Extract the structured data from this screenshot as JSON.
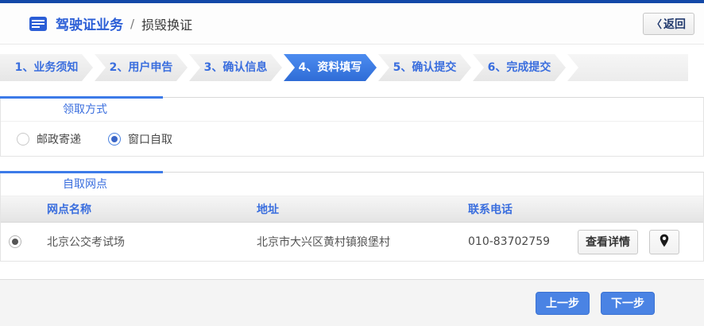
{
  "header": {
    "title": "驾驶证业务",
    "separator": "/",
    "subtitle": "损毁换证",
    "back_chevron": "〈",
    "back_label": "返回"
  },
  "steps": {
    "items": [
      {
        "label": "1、业务须知",
        "active": false
      },
      {
        "label": "2、用户申告",
        "active": false
      },
      {
        "label": "3、确认信息",
        "active": false
      },
      {
        "label": "4、资料填写",
        "active": true
      },
      {
        "label": "5、确认提交",
        "active": false
      },
      {
        "label": "6、完成提交",
        "active": false
      }
    ]
  },
  "pickup": {
    "title": "领取方式",
    "options": [
      {
        "label": "邮政寄递",
        "selected": false
      },
      {
        "label": "窗口自取",
        "selected": true
      }
    ]
  },
  "outlets": {
    "title": "自取网点",
    "columns": [
      "网点名称",
      "地址",
      "联系电话"
    ],
    "rows": [
      {
        "selected": true,
        "name": "北京公交考试场",
        "address": "北京市大兴区黄村镇狼堡村",
        "phone": "010-83702759",
        "detail_label": "查看详情",
        "map_icon": "location-pin"
      }
    ]
  },
  "footer": {
    "prev_label": "上一步",
    "next_label": "下一步"
  },
  "colors": {
    "top_bar": "#1349a8",
    "accent_blue": "#3d7be8",
    "active_step_blue": "#2f6cd6",
    "link_blue": "#3a6ede",
    "button_blue": "#4a83e4"
  }
}
